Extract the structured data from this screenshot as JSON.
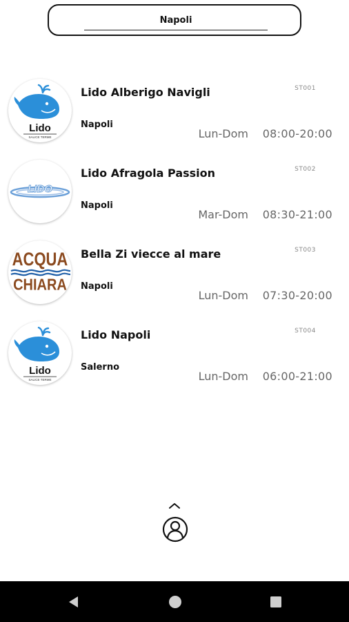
{
  "search": {
    "value": "Napoli"
  },
  "items": [
    {
      "name": "Lido Alberigo Navigli",
      "city": "Napoli",
      "code": "ST001",
      "days": "Lun-Dom",
      "hours": "08:00-20:00",
      "logo": {
        "icon": "whale-logo",
        "text": "Lido",
        "subtext": "SALICE TERME",
        "color": "#2b8fd9"
      }
    },
    {
      "name": "Lido Afragola Passion",
      "city": "Napoli",
      "code": "ST002",
      "days": "Mar-Dom",
      "hours": "08:30-21:00",
      "logo": {
        "icon": "lido-ring-logo",
        "text": "LIDO",
        "color": "#6a9fd8"
      }
    },
    {
      "name": "Bella Zi viecce al mare",
      "city": "Napoli",
      "code": "ST003",
      "days": "Lun-Dom",
      "hours": "07:30-20:00",
      "logo": {
        "icon": "acqua-chiara-logo",
        "text_top": "ACQUA",
        "text_bottom": "CHIARA",
        "color": "#8b4a1f",
        "wave_color": "#1f5fa8"
      }
    },
    {
      "name": "Lido Napoli",
      "city": "Salerno",
      "code": "ST004",
      "days": "Lun-Dom",
      "hours": "06:00-21:00",
      "logo": {
        "icon": "whale-logo",
        "text": "Lido",
        "subtext": "SALICE TERME",
        "color": "#2b8fd9"
      }
    }
  ],
  "footer": {
    "chevron_icon": "chevron-up-icon",
    "profile_icon": "user-profile-icon"
  },
  "navbar": {
    "back_icon": "back-triangle-icon",
    "home_icon": "home-circle-icon",
    "recents_icon": "recents-square-icon"
  }
}
